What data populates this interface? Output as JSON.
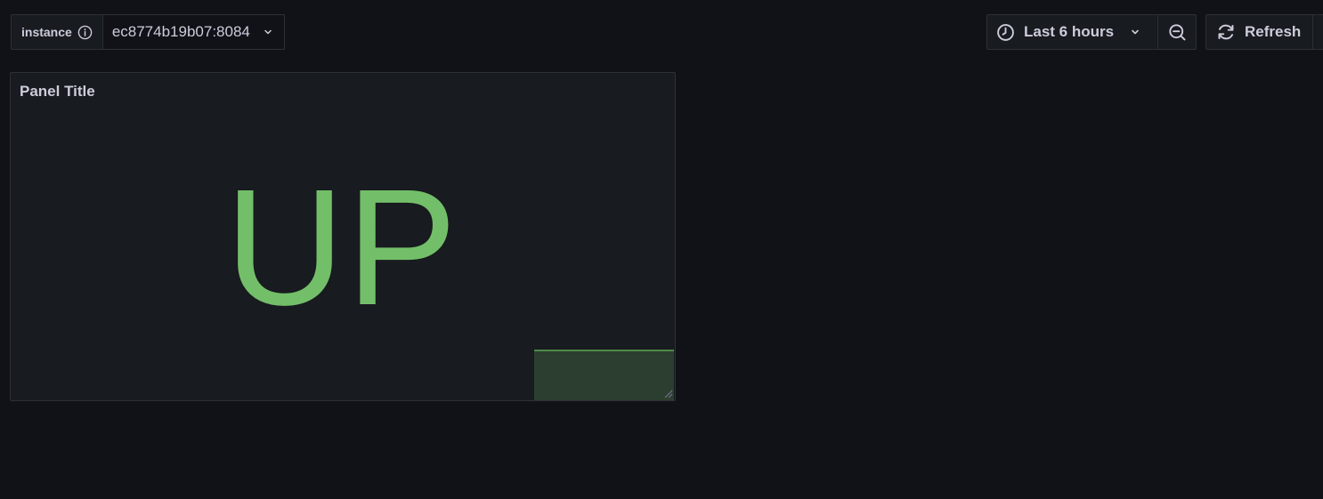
{
  "variables": {
    "instance_label": "instance",
    "instance_value": "ec8774b19b07:8084"
  },
  "toolbar": {
    "time_range_label": "Last 6 hours",
    "refresh_label": "Refresh"
  },
  "panel": {
    "title": "Panel Title",
    "stat_value": "UP",
    "stat_color": "#73bf69",
    "sparkline_color": "#4d8a46"
  },
  "icons": {
    "info": "info-circle-icon",
    "dropdown": "chevron-down-icon",
    "clock": "clock-icon",
    "zoom_out": "zoom-out-icon",
    "refresh": "sync-icon"
  }
}
